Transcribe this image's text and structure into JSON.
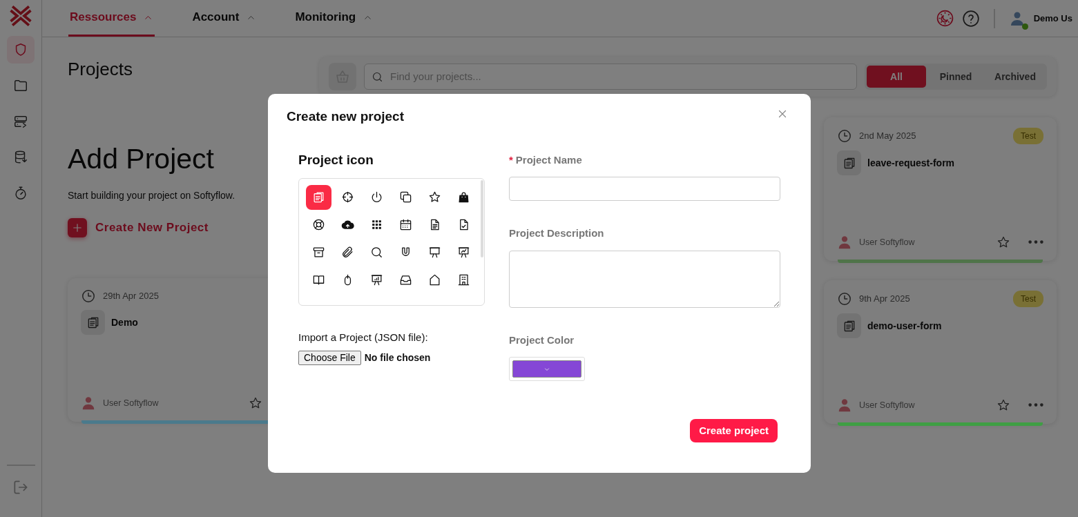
{
  "sidebar": {
    "items": [
      {
        "kind": "shield",
        "selected": true
      },
      {
        "kind": "folder",
        "selected": false
      },
      {
        "kind": "server",
        "selected": false
      },
      {
        "kind": "database",
        "selected": false
      },
      {
        "kind": "timer",
        "selected": false
      }
    ],
    "footer_items": [
      {
        "kind": "logout"
      }
    ]
  },
  "nav": {
    "tabs": [
      {
        "label": "Ressources",
        "selected": true
      },
      {
        "label": "Account",
        "selected": false
      },
      {
        "label": "Monitoring",
        "selected": false
      }
    ],
    "user": {
      "name": "Demo Us",
      "online": true
    }
  },
  "page": {
    "title": "Projects",
    "search": {
      "placeholder": "Find your projects..."
    },
    "filters": [
      {
        "label": "All",
        "selected": true
      },
      {
        "label": "Pinned",
        "selected": false
      },
      {
        "label": "Archived",
        "selected": false
      }
    ],
    "left_column": {
      "add_project": {
        "title": "Add Project",
        "subtitle": "Start building your project on Softyflow.",
        "button": "Create New Project"
      },
      "cards": [
        {
          "date": "29th Apr 2025",
          "name": "Demo",
          "owner": "User Softyflow",
          "color": "#4a7a8c"
        }
      ]
    },
    "right_column": {
      "cards": [
        {
          "date": "2nd May 2025",
          "tag": "Test",
          "name": "leave-request-form",
          "owner": "User Softyflow",
          "menu": true,
          "color": "#4f7449"
        },
        {
          "date": "9th Apr 2025",
          "tag": "Test",
          "name": "demo-user-form",
          "owner": "User Softyflow",
          "menu": true,
          "color": "#3f9e44"
        }
      ]
    }
  },
  "modal": {
    "title": "Create new project",
    "icon_picker": {
      "label": "Project icon",
      "icons": [
        {
          "kind": "files",
          "selected": true
        },
        {
          "kind": "crosshair",
          "selected": false
        },
        {
          "kind": "power",
          "selected": false
        },
        {
          "kind": "copy",
          "selected": false
        },
        {
          "kind": "star",
          "selected": false
        },
        {
          "kind": "bag",
          "selected": false
        },
        {
          "kind": "lifebuoy",
          "selected": false
        },
        {
          "kind": "cloud-upload",
          "selected": false
        },
        {
          "kind": "grid",
          "selected": false
        },
        {
          "kind": "calendar",
          "selected": false
        },
        {
          "kind": "file-text",
          "selected": false
        },
        {
          "kind": "file-check",
          "selected": false
        },
        {
          "kind": "archive",
          "selected": false
        },
        {
          "kind": "paperclip",
          "selected": false
        },
        {
          "kind": "search",
          "selected": false
        },
        {
          "kind": "magnet",
          "selected": false
        },
        {
          "kind": "easel",
          "selected": false
        },
        {
          "kind": "easel-chart",
          "selected": false
        },
        {
          "kind": "book",
          "selected": false
        },
        {
          "kind": "mouse",
          "selected": false
        },
        {
          "kind": "easel-bars",
          "selected": false
        },
        {
          "kind": "inbox",
          "selected": false
        },
        {
          "kind": "home",
          "selected": false
        },
        {
          "kind": "building",
          "selected": false
        }
      ]
    },
    "import": {
      "label": "Import a Project (JSON file):",
      "button": "Choose File",
      "status": "No file chosen"
    },
    "fields": [
      {
        "kind": "text",
        "label": "Project Name",
        "required_mark": "*"
      },
      {
        "kind": "textarea",
        "label": "Project Description"
      },
      {
        "kind": "color",
        "label": "Project Color",
        "color": "#8547d6"
      }
    ],
    "submit": "Create project"
  }
}
